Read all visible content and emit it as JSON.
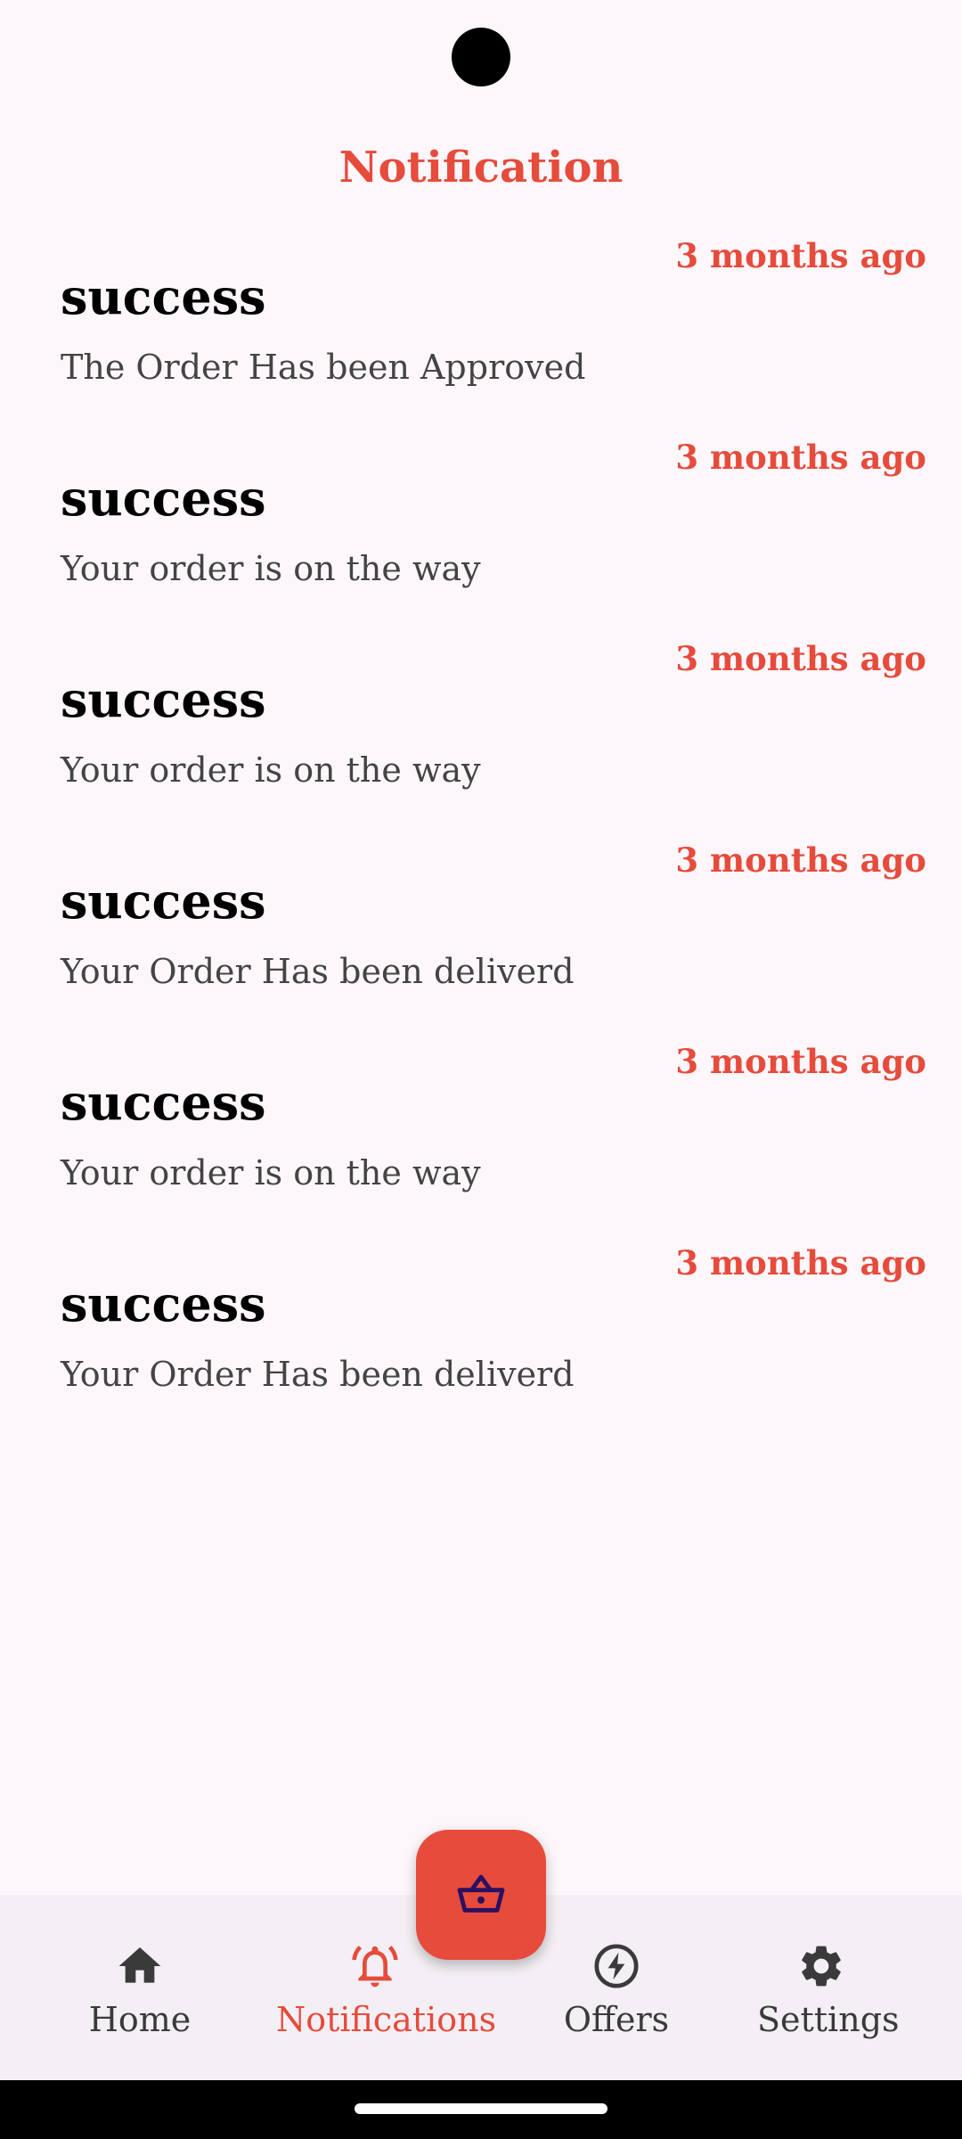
{
  "header": {
    "title": "Notification"
  },
  "notifications": [
    {
      "time": "3 months ago",
      "title": "success",
      "body": "The Order Has been Approved"
    },
    {
      "time": "3 months ago",
      "title": "success",
      "body": "Your order is on the way"
    },
    {
      "time": "3 months ago",
      "title": "success",
      "body": "Your order is on the way"
    },
    {
      "time": "3 months ago",
      "title": "success",
      "body": "Your Order Has been deliverd"
    },
    {
      "time": "3 months ago",
      "title": "success",
      "body": "Your order is on the way"
    },
    {
      "time": "3 months ago",
      "title": "success",
      "body": "Your Order Has been deliverd"
    }
  ],
  "bottom_nav": {
    "items": [
      {
        "label": "Home",
        "icon": "home-icon"
      },
      {
        "label": "Notifications",
        "icon": "bell-icon",
        "active": true
      },
      {
        "label": "Offers",
        "icon": "bolt-icon"
      },
      {
        "label": "Settings",
        "icon": "gear-icon"
      }
    ]
  },
  "fab": {
    "icon": "basket-icon"
  },
  "colors": {
    "accent": "#e64b3c",
    "background": "#fdf7fb",
    "nav_background": "#f3eff4",
    "basket_icon": "#2a1060"
  }
}
